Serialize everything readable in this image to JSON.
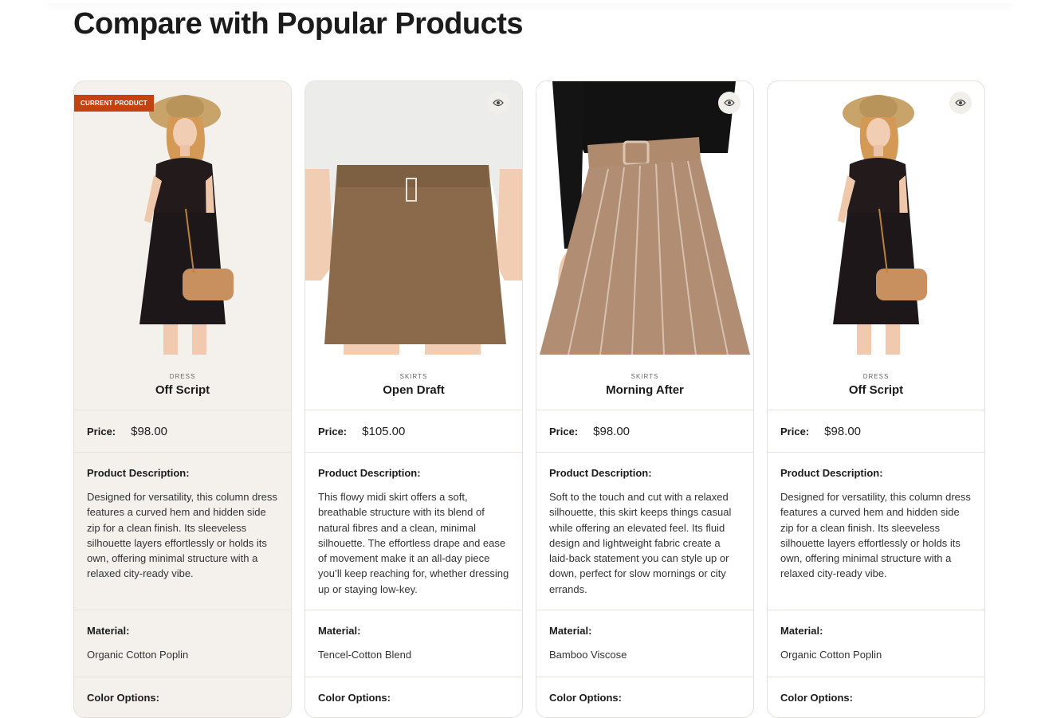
{
  "page": {
    "title": "Compare with Popular Products"
  },
  "labels": {
    "current_badge": "CURRENT PRODUCT",
    "price": "Price:",
    "description": "Product Description:",
    "material": "Material:",
    "color_options": "Color Options:"
  },
  "icons": {
    "eye": "eye-icon"
  },
  "colors": {
    "badge": "#c5410f",
    "current_card_bg": "#f4f1ec"
  },
  "products": [
    {
      "category": "DRESS",
      "name": "Off Script",
      "price": "$98.00",
      "description": "Designed for versatility, this column dress features a curved hem and hidden side zip for a clean finish. Its sleeveless silhouette layers effortlessly or holds its own, offering minimal structure with a relaxed city-ready vibe.",
      "material": "Organic Cotton Poplin"
    },
    {
      "category": "SKIRTS",
      "name": "Open Draft",
      "price": "$105.00",
      "description": "This flowy midi skirt offers a soft, breathable structure with its blend of natural fibres and a clean, minimal silhouette. The effortless drape and ease of movement make it an all-day piece you’ll keep reaching for, whether dressing up or staying low-key.",
      "material": "Tencel-Cotton Blend"
    },
    {
      "category": "SKIRTS",
      "name": "Morning After",
      "price": "$98.00",
      "description": "Soft to the touch and cut with a relaxed silhouette, this skirt keeps things casual while offering an elevated feel. Its fluid design and lightweight fabric create a laid-back statement you can style up or down, perfect for slow mornings or city errands.",
      "material": "Bamboo Viscose"
    },
    {
      "category": "DRESS",
      "name": "Off Script",
      "price": "$98.00",
      "description": "Designed for versatility, this column dress features a curved hem and hidden side zip for a clean finish. Its sleeveless silhouette layers effortlessly or holds its own, offering minimal structure with a relaxed city-ready vibe.",
      "material": "Organic Cotton Poplin"
    }
  ]
}
